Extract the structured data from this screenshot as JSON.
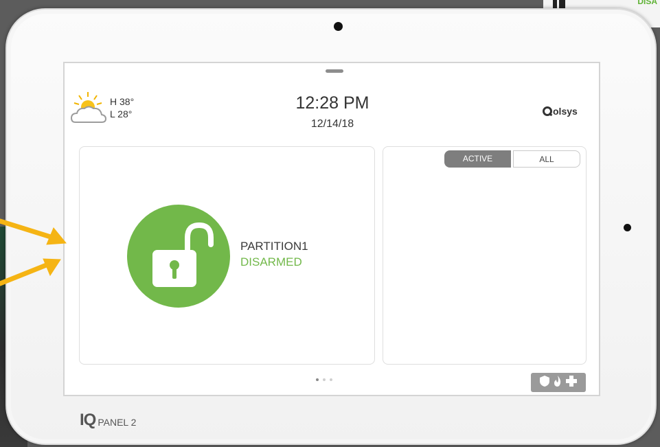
{
  "header": {
    "weather": {
      "icon": "partly-cloudy-icon",
      "high": "H 38°",
      "low": "L 28°"
    },
    "time": "12:28 PM",
    "date": "12/14/18",
    "brand_logo": "olsys"
  },
  "partition": {
    "name": "PARTITION1",
    "status": "DISARMED",
    "icon": "unlocked-padlock-icon",
    "status_color": "#72b84a"
  },
  "events": {
    "tabs": [
      {
        "label": "ACTIVE",
        "selected": true
      },
      {
        "label": "ALL",
        "selected": false
      }
    ]
  },
  "pager": {
    "pages": 3,
    "current": 1
  },
  "emergency": {
    "icons": [
      "shield-icon",
      "fire-icon",
      "plus-icon"
    ]
  },
  "indicators": {
    "colors": [
      "#5aa82f",
      "#f0c44a",
      "#b9e0a5",
      "#dd5b4b"
    ]
  },
  "device": {
    "brand_label": "PANEL 2",
    "brand_prefix": "IQ"
  },
  "background": {
    "corner_text": "DISA"
  }
}
